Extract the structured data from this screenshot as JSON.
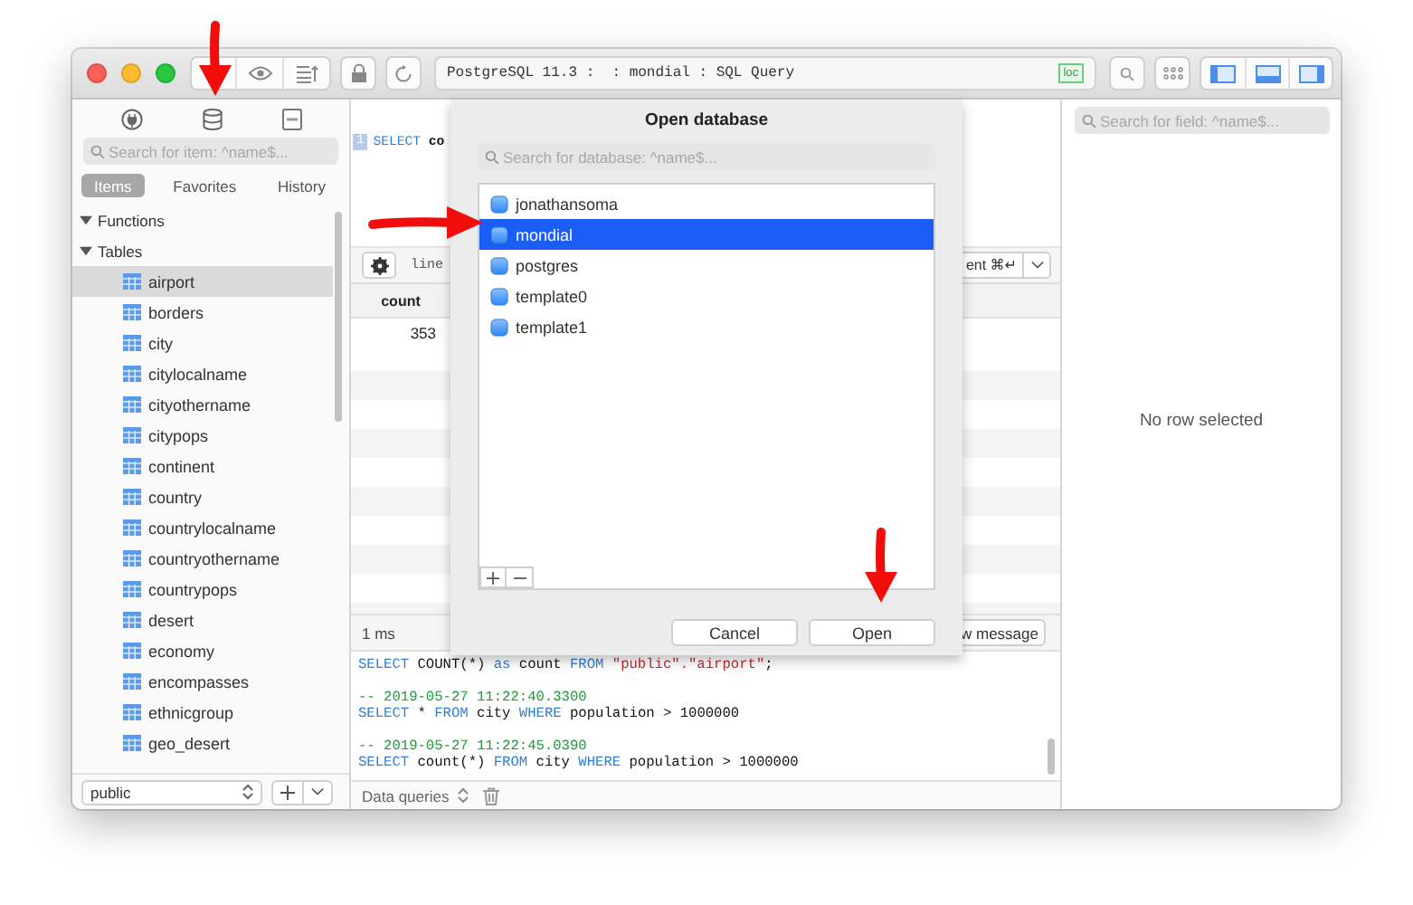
{
  "toolbar": {
    "address": "PostgreSQL 11.3 :  : mondial : SQL Query",
    "badge": "loc"
  },
  "sidebar": {
    "search": {
      "placeholder": "Search for item: ^name$..."
    },
    "tabs": [
      {
        "label": "Items",
        "selected": true
      },
      {
        "label": "Favorites",
        "selected": false
      },
      {
        "label": "History",
        "selected": false
      }
    ],
    "tree": [
      {
        "label": "Functions",
        "expanded": true
      },
      {
        "label": "Tables",
        "expanded": true,
        "children": [
          {
            "label": "airport",
            "selected": true
          },
          {
            "label": "borders",
            "selected": false
          },
          {
            "label": "city",
            "selected": false
          },
          {
            "label": "citylocalname",
            "selected": false
          },
          {
            "label": "cityothername",
            "selected": false
          },
          {
            "label": "citypops",
            "selected": false
          },
          {
            "label": "continent",
            "selected": false
          },
          {
            "label": "country",
            "selected": false
          },
          {
            "label": "countrylocalname",
            "selected": false
          },
          {
            "label": "countryothername",
            "selected": false
          },
          {
            "label": "countrypops",
            "selected": false
          },
          {
            "label": "desert",
            "selected": false
          },
          {
            "label": "economy",
            "selected": false
          },
          {
            "label": "encompasses",
            "selected": false
          },
          {
            "label": "ethnicgroup",
            "selected": false
          },
          {
            "label": "geo_desert",
            "selected": false
          }
        ]
      }
    ],
    "schema": "public"
  },
  "editor": {
    "line_number": "1",
    "tokens": [
      {
        "text": "SELECT",
        "kind": "keyword"
      },
      {
        "text": " co",
        "kind": "plain"
      }
    ]
  },
  "editor_toolbar": {
    "position": "line",
    "run_button": "ent ⌘↵"
  },
  "results": {
    "columns": [
      "count"
    ],
    "rows": [
      [
        "353"
      ]
    ]
  },
  "status": {
    "time": "1 ms",
    "message_button": "w message"
  },
  "log": {
    "entries": [
      {
        "statement": [
          {
            "text": "SELECT",
            "kind": "keyword"
          },
          {
            "text": " COUNT(*) ",
            "kind": "plain"
          },
          {
            "text": "as",
            "kind": "keyword"
          },
          {
            "text": " count ",
            "kind": "plain"
          },
          {
            "text": "FROM",
            "kind": "keyword"
          },
          {
            "text": " \"public\".\"airport\"",
            "kind": "string"
          },
          {
            "text": ";",
            "kind": "plain"
          }
        ]
      },
      {
        "comment": "-- 2019-05-27 11:22:40.3300",
        "statement": [
          {
            "text": "SELECT",
            "kind": "keyword"
          },
          {
            "text": " * ",
            "kind": "plain"
          },
          {
            "text": "FROM",
            "kind": "keyword"
          },
          {
            "text": " city ",
            "kind": "plain"
          },
          {
            "text": "WHERE",
            "kind": "keyword"
          },
          {
            "text": " population > 1000000",
            "kind": "plain"
          }
        ]
      },
      {
        "comment": "-- 2019-05-27 11:22:45.0390",
        "statement": [
          {
            "text": "SELECT",
            "kind": "keyword"
          },
          {
            "text": " count(*) ",
            "kind": "plain"
          },
          {
            "text": "FROM",
            "kind": "keyword"
          },
          {
            "text": " city ",
            "kind": "plain"
          },
          {
            "text": "WHERE",
            "kind": "keyword"
          },
          {
            "text": " population > 1000000",
            "kind": "plain"
          }
        ]
      }
    ]
  },
  "log_bar": {
    "filter": "Data queries"
  },
  "detail": {
    "search": {
      "placeholder": "Search for field: ^name$..."
    },
    "empty": "No row selected"
  },
  "dialog": {
    "title": "Open database",
    "search": {
      "placeholder": "Search for database: ^name$..."
    },
    "databases": [
      {
        "name": "jonathansoma",
        "selected": false
      },
      {
        "name": "mondial",
        "selected": true
      },
      {
        "name": "postgres",
        "selected": false
      },
      {
        "name": "template0",
        "selected": false
      },
      {
        "name": "template1",
        "selected": false
      }
    ],
    "buttons": [
      "Cancel",
      "Open"
    ]
  },
  "annotations": [
    {
      "kind": "arrow_down"
    },
    {
      "kind": "arrow_right"
    },
    {
      "kind": "arrow_down"
    }
  ]
}
